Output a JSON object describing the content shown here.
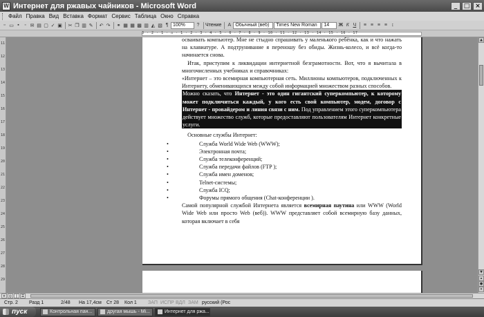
{
  "window": {
    "title": "Интернет для ржавых чайников - Microsoft Word",
    "app_icon": "W"
  },
  "menu": [
    "Файл",
    "Правка",
    "Вид",
    "Вставка",
    "Формат",
    "Сервис",
    "Таблица",
    "Окно",
    "Справка"
  ],
  "toolbar": {
    "zoom": "100%",
    "reading_label": "Чтение",
    "style": "Обычный (веб)",
    "font": "Times New Roman",
    "size": "14",
    "bold": "Ж",
    "italic": "К",
    "underline": "Ч"
  },
  "ruler_ticks": "3 · 2 · 1 · ⌂ · 1 · 2 · 3 · 4 · 5 · 6 · 7 · 8 · 9 · 10 · 11 · 12 · 13 · 14 · 15 · 16 · 17",
  "vruler_ticks": [
    "11",
    "12",
    "13",
    "14",
    "15",
    "16",
    "17",
    "18",
    "19",
    "20",
    "21",
    "22",
    "23",
    "24",
    "25",
    "26",
    "27",
    "28",
    "29"
  ],
  "document": {
    "p1_cut": "осваивать компьютер. Мне не стыдно спрашивать у маленького ребёнка, как и что нажать на клавиатуре. А подтрунивание я переношу без обиды. Жизнь-колесо, и всё когда-то начинается снова.",
    "p2": "Итак, приступим к ликвидации интернетной безграмотности. Вот, что я вычитала в многочисленных учебниках и справочниках:",
    "p3": "«Интернет – это всемирная компьютерная сеть. Миллионы компьютеров, подключенных к Интернету, обменивающихся между собой информацией множеством разных способов.",
    "hl_a": "Можно сказать, что ",
    "hl_b": "Интернет - это один гигантский суперкомпьютер, к которому может подключиться каждый, у кого есть свой компьютер, модем, договор с Интернет - провайдером и линия связи с ним.",
    "hl_c": " Под управлением этого суперкомпьютера действует множество служб, которые предоставляют пользователям Интернет конкретные услуги.",
    "services_heading": "Основные службы Интернет:",
    "services": [
      "Служба World Wide Web (WWW);",
      "Электронная почта;",
      "Служба телеконференций;",
      "Служба передачи файлов (FTP );",
      "Служба имен доменов;",
      "Telnet-системы;",
      "Служба ICQ;",
      "Форумы прямого общения (Chat-конференции )."
    ],
    "p4_a": "Самой популярной службой Интернета является ",
    "p4_b": "всемирная паутина",
    "p4_c": " или WWW (World Wide Web или просто Web (веб)). WWW представляет собой всемирную базу данных, которая включает в себя"
  },
  "status": {
    "page": "Стр. 2",
    "section": "Разд 1",
    "pages": "2/48",
    "position": "На 17,4см",
    "line": "Ст 28",
    "column": "Кол 1",
    "rec": "ЗАП",
    "trk": "ИСПР",
    "ext": "ВДЛ",
    "ovr": "ЗАМ",
    "lang": "русский (Рос"
  },
  "taskbar": {
    "start": "пуск",
    "tasks": [
      "Контрольная пан...",
      "другая мышь - Mi...",
      "Интернет для ржа..."
    ]
  }
}
